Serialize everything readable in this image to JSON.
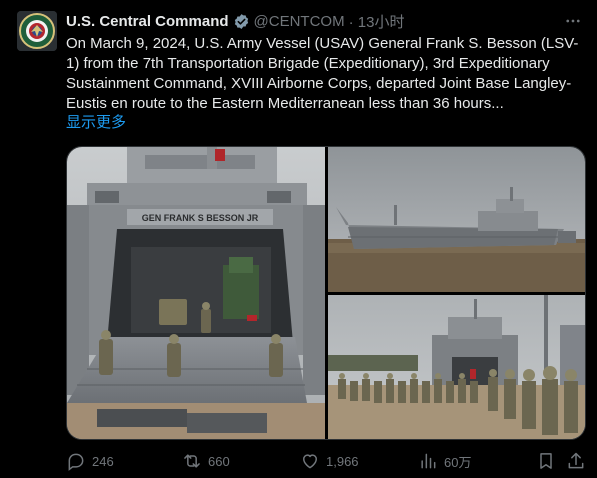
{
  "author": {
    "name": "U.S. Central Command",
    "handle": "@CENTCOM",
    "time": "· 13小时"
  },
  "tweet": {
    "text": "On March 9, 2024, U.S. Army Vessel (USAV) General Frank S. Besson (LSV-1) from the 7th Transportation Brigade (Expeditionary), 3rd Expeditionary Sustainment Command, XVIII Airborne Corps, departed Joint Base Langley-Eustis en route to the Eastern Mediterranean less than 36 hours...",
    "show_more": "显示更多"
  },
  "media": {
    "photo1_ship_sign": "GEN FRANK S BESSON JR"
  },
  "actions": {
    "replies": "246",
    "reposts": "660",
    "likes": "1,966",
    "views": "60万"
  },
  "colors": {
    "background": "#000000",
    "text": "#e7e9ea",
    "secondary": "#71767b",
    "link": "#1d9bf0",
    "verified_badge": "#829aab"
  },
  "icons": {
    "verified": "verified-badge-icon",
    "more": "more-icon",
    "reply": "reply-icon",
    "repost": "repost-icon",
    "like": "like-icon",
    "views": "views-icon",
    "bookmark": "bookmark-icon",
    "share": "share-icon"
  }
}
